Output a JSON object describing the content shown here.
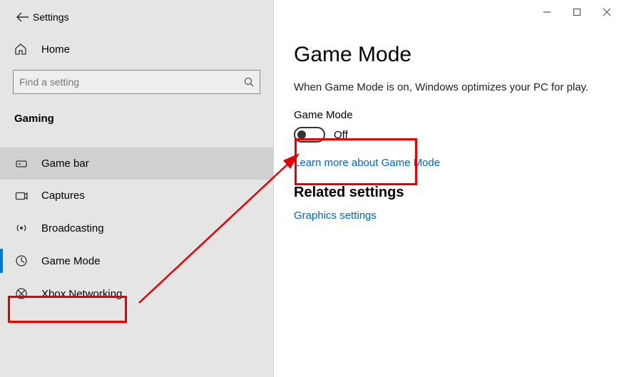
{
  "header": {
    "settings_label": "Settings"
  },
  "sidebar": {
    "home_label": "Home",
    "search_placeholder": "Find a setting",
    "category_header": "Gaming",
    "items": [
      {
        "label": "Game bar"
      },
      {
        "label": "Captures"
      },
      {
        "label": "Broadcasting"
      },
      {
        "label": "Game Mode"
      },
      {
        "label": "Xbox Networking"
      }
    ]
  },
  "main": {
    "title": "Game Mode",
    "description": "When Game Mode is on, Windows optimizes your PC for play.",
    "setting_label": "Game Mode",
    "toggle_state": "Off",
    "learn_more": "Learn more about Game Mode",
    "related_heading": "Related settings",
    "graphics_link": "Graphics settings"
  }
}
